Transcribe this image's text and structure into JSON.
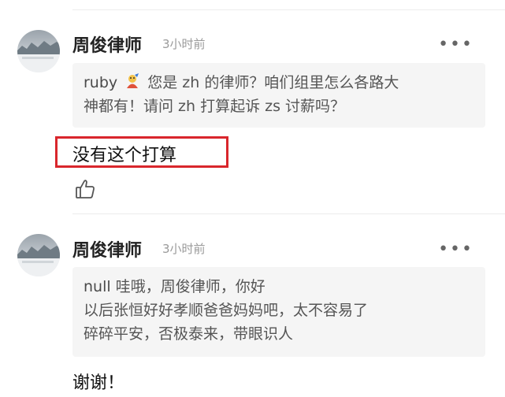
{
  "comments": [
    {
      "author": "周俊律师",
      "time": "3小时前",
      "more": "•••",
      "quote_user": "ruby",
      "quote_lines": [
        "您是 zh 的律师？咱们组里怎么各路大",
        "神都有！请问 zh 打算起诉 zs 讨薪吗？"
      ],
      "reply": "没有这个打算",
      "like_icon": "thumbs-up-icon"
    },
    {
      "author": "周俊律师",
      "time": "3小时前",
      "more": "•••",
      "quote_user": "null",
      "quote_lines": [
        "哇哦，周俊律师，你好",
        "以后张恒好好孝顺爸爸妈妈吧，太不容易了",
        "碎碎平安，否极泰来，带眼识人"
      ],
      "reply": "谢谢！"
    }
  ],
  "colors": {
    "highlight_border": "#d9262c",
    "quote_bg": "#f5f5f5",
    "time_gray": "#9a9a9a"
  }
}
